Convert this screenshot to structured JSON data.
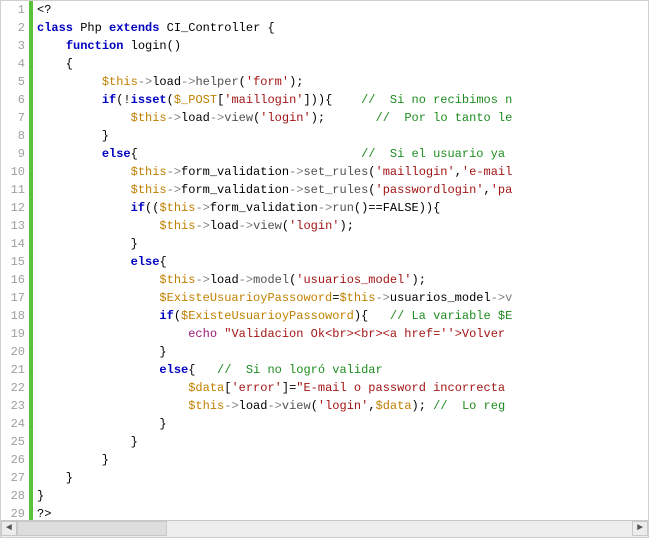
{
  "code": {
    "lines": [
      {
        "n": "1",
        "frags": [
          {
            "c": "op",
            "t": "<?"
          }
        ]
      },
      {
        "n": "2",
        "frags": [
          {
            "c": "k",
            "t": "class"
          },
          {
            "c": "id",
            "t": " Php "
          },
          {
            "c": "k",
            "t": "extends"
          },
          {
            "c": "id",
            "t": " CI_Controller "
          },
          {
            "c": "op",
            "t": "{"
          }
        ]
      },
      {
        "n": "3",
        "frags": [
          {
            "c": "op",
            "t": "    "
          },
          {
            "c": "k",
            "t": "function"
          },
          {
            "c": "id",
            "t": " login"
          },
          {
            "c": "op",
            "t": "()"
          }
        ]
      },
      {
        "n": "4",
        "frags": [
          {
            "c": "op",
            "t": "    {"
          }
        ]
      },
      {
        "n": "5",
        "frags": [
          {
            "c": "op",
            "t": "         "
          },
          {
            "c": "var",
            "t": "$this"
          },
          {
            "c": "arr",
            "t": "->"
          },
          {
            "c": "id",
            "t": "load"
          },
          {
            "c": "arr",
            "t": "->"
          },
          {
            "c": "fn",
            "t": "helper"
          },
          {
            "c": "op",
            "t": "("
          },
          {
            "c": "str",
            "t": "'form'"
          },
          {
            "c": "op",
            "t": ");"
          }
        ]
      },
      {
        "n": "6",
        "frags": [
          {
            "c": "op",
            "t": "         "
          },
          {
            "c": "k",
            "t": "if"
          },
          {
            "c": "op",
            "t": "(!"
          },
          {
            "c": "k",
            "t": "isset"
          },
          {
            "c": "op",
            "t": "("
          },
          {
            "c": "var",
            "t": "$_POST"
          },
          {
            "c": "op",
            "t": "["
          },
          {
            "c": "str",
            "t": "'maillogin'"
          },
          {
            "c": "op",
            "t": "])){    "
          },
          {
            "c": "cmt",
            "t": "//  Si no recibimos n"
          }
        ]
      },
      {
        "n": "7",
        "frags": [
          {
            "c": "op",
            "t": "             "
          },
          {
            "c": "var",
            "t": "$this"
          },
          {
            "c": "arr",
            "t": "->"
          },
          {
            "c": "id",
            "t": "load"
          },
          {
            "c": "arr",
            "t": "->"
          },
          {
            "c": "fn",
            "t": "view"
          },
          {
            "c": "op",
            "t": "("
          },
          {
            "c": "str",
            "t": "'login'"
          },
          {
            "c": "op",
            "t": ");       "
          },
          {
            "c": "cmt",
            "t": "//  Por lo tanto le"
          }
        ]
      },
      {
        "n": "8",
        "frags": [
          {
            "c": "op",
            "t": "         }"
          }
        ]
      },
      {
        "n": "9",
        "frags": [
          {
            "c": "op",
            "t": "         "
          },
          {
            "c": "k",
            "t": "else"
          },
          {
            "c": "op",
            "t": "{                               "
          },
          {
            "c": "cmt",
            "t": "//  Si el usuario ya"
          }
        ]
      },
      {
        "n": "10",
        "frags": [
          {
            "c": "op",
            "t": "             "
          },
          {
            "c": "var",
            "t": "$this"
          },
          {
            "c": "arr",
            "t": "->"
          },
          {
            "c": "id",
            "t": "form_validation"
          },
          {
            "c": "arr",
            "t": "->"
          },
          {
            "c": "fn",
            "t": "set_rules"
          },
          {
            "c": "op",
            "t": "("
          },
          {
            "c": "str",
            "t": "'maillogin'"
          },
          {
            "c": "op",
            "t": ","
          },
          {
            "c": "str",
            "t": "'e-mail"
          }
        ]
      },
      {
        "n": "11",
        "frags": [
          {
            "c": "op",
            "t": "             "
          },
          {
            "c": "var",
            "t": "$this"
          },
          {
            "c": "arr",
            "t": "->"
          },
          {
            "c": "id",
            "t": "form_validation"
          },
          {
            "c": "arr",
            "t": "->"
          },
          {
            "c": "fn",
            "t": "set_rules"
          },
          {
            "c": "op",
            "t": "("
          },
          {
            "c": "str",
            "t": "'passwordlogin'"
          },
          {
            "c": "op",
            "t": ","
          },
          {
            "c": "str",
            "t": "'pa"
          }
        ]
      },
      {
        "n": "12",
        "frags": [
          {
            "c": "op",
            "t": "             "
          },
          {
            "c": "k",
            "t": "if"
          },
          {
            "c": "op",
            "t": "(("
          },
          {
            "c": "var",
            "t": "$this"
          },
          {
            "c": "arr",
            "t": "->"
          },
          {
            "c": "id",
            "t": "form_validation"
          },
          {
            "c": "arr",
            "t": "->"
          },
          {
            "c": "fn",
            "t": "run"
          },
          {
            "c": "op",
            "t": "()==FALSE)){"
          }
        ]
      },
      {
        "n": "13",
        "frags": [
          {
            "c": "op",
            "t": "                 "
          },
          {
            "c": "var",
            "t": "$this"
          },
          {
            "c": "arr",
            "t": "->"
          },
          {
            "c": "id",
            "t": "load"
          },
          {
            "c": "arr",
            "t": "->"
          },
          {
            "c": "fn",
            "t": "view"
          },
          {
            "c": "op",
            "t": "("
          },
          {
            "c": "str",
            "t": "'login'"
          },
          {
            "c": "op",
            "t": ");"
          }
        ]
      },
      {
        "n": "14",
        "frags": [
          {
            "c": "op",
            "t": "             }"
          }
        ]
      },
      {
        "n": "15",
        "frags": [
          {
            "c": "op",
            "t": "             "
          },
          {
            "c": "k",
            "t": "else"
          },
          {
            "c": "op",
            "t": "{"
          }
        ]
      },
      {
        "n": "16",
        "frags": [
          {
            "c": "op",
            "t": "                 "
          },
          {
            "c": "var",
            "t": "$this"
          },
          {
            "c": "arr",
            "t": "->"
          },
          {
            "c": "id",
            "t": "load"
          },
          {
            "c": "arr",
            "t": "->"
          },
          {
            "c": "fn",
            "t": "model"
          },
          {
            "c": "op",
            "t": "("
          },
          {
            "c": "str",
            "t": "'usuarios_model'"
          },
          {
            "c": "op",
            "t": ");"
          }
        ]
      },
      {
        "n": "17",
        "frags": [
          {
            "c": "op",
            "t": "                 "
          },
          {
            "c": "var",
            "t": "$ExisteUsuarioyPassoword"
          },
          {
            "c": "op",
            "t": "="
          },
          {
            "c": "var",
            "t": "$this"
          },
          {
            "c": "arr",
            "t": "->"
          },
          {
            "c": "id",
            "t": "usuarios_model"
          },
          {
            "c": "arr",
            "t": "->v"
          }
        ]
      },
      {
        "n": "18",
        "frags": [
          {
            "c": "op",
            "t": "                 "
          },
          {
            "c": "k",
            "t": "if"
          },
          {
            "c": "op",
            "t": "("
          },
          {
            "c": "var",
            "t": "$ExisteUsuarioyPassoword"
          },
          {
            "c": "op",
            "t": "){   "
          },
          {
            "c": "cmt",
            "t": "// La variable $E"
          }
        ]
      },
      {
        "n": "19",
        "frags": [
          {
            "c": "op",
            "t": "                     "
          },
          {
            "c": "macro",
            "t": "echo"
          },
          {
            "c": "op",
            "t": " "
          },
          {
            "c": "str",
            "t": "\"Validacion Ok<br><br><a href=''>Volver"
          }
        ]
      },
      {
        "n": "20",
        "frags": [
          {
            "c": "op",
            "t": "                 }"
          }
        ]
      },
      {
        "n": "21",
        "frags": [
          {
            "c": "op",
            "t": "                 "
          },
          {
            "c": "k",
            "t": "else"
          },
          {
            "c": "op",
            "t": "{   "
          },
          {
            "c": "cmt",
            "t": "//  Si no logró validar"
          }
        ]
      },
      {
        "n": "22",
        "frags": [
          {
            "c": "op",
            "t": "                     "
          },
          {
            "c": "var",
            "t": "$data"
          },
          {
            "c": "op",
            "t": "["
          },
          {
            "c": "str",
            "t": "'error'"
          },
          {
            "c": "op",
            "t": "]="
          },
          {
            "c": "str",
            "t": "\"E-mail o password incorrecta"
          }
        ]
      },
      {
        "n": "23",
        "frags": [
          {
            "c": "op",
            "t": "                     "
          },
          {
            "c": "var",
            "t": "$this"
          },
          {
            "c": "arr",
            "t": "->"
          },
          {
            "c": "id",
            "t": "load"
          },
          {
            "c": "arr",
            "t": "->"
          },
          {
            "c": "fn",
            "t": "view"
          },
          {
            "c": "op",
            "t": "("
          },
          {
            "c": "str",
            "t": "'login'"
          },
          {
            "c": "op",
            "t": ","
          },
          {
            "c": "var",
            "t": "$data"
          },
          {
            "c": "op",
            "t": "); "
          },
          {
            "c": "cmt",
            "t": "//  Lo reg"
          }
        ]
      },
      {
        "n": "24",
        "frags": [
          {
            "c": "op",
            "t": "                 }"
          }
        ]
      },
      {
        "n": "25",
        "frags": [
          {
            "c": "op",
            "t": "             }"
          }
        ]
      },
      {
        "n": "26",
        "frags": [
          {
            "c": "op",
            "t": "         }"
          }
        ]
      },
      {
        "n": "27",
        "frags": [
          {
            "c": "op",
            "t": "    }"
          }
        ]
      },
      {
        "n": "28",
        "frags": [
          {
            "c": "op",
            "t": "}"
          }
        ]
      },
      {
        "n": "29",
        "frags": [
          {
            "c": "op",
            "t": "?>"
          }
        ]
      }
    ]
  },
  "scrollbar": {
    "left_glyph": "◄",
    "right_glyph": "►"
  }
}
